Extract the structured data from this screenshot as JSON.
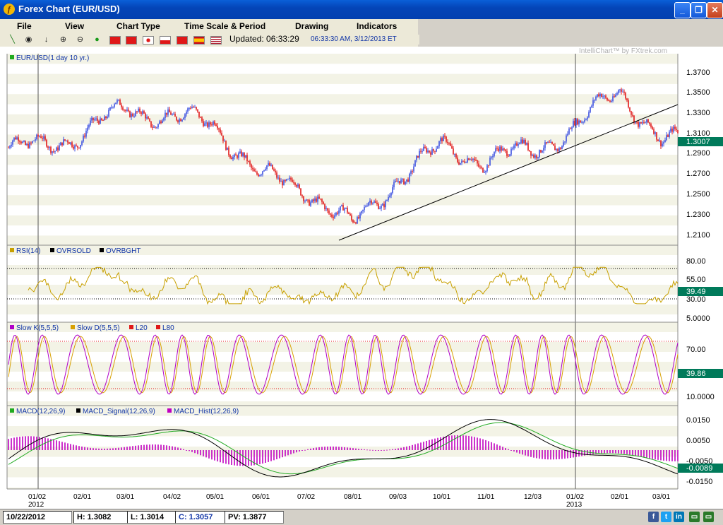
{
  "window": {
    "title": "Forex Chart (EUR/USD)",
    "app_icon": "ƒ"
  },
  "menu": [
    "File",
    "View",
    "Chart Type",
    "Time Scale & Period",
    "Drawing",
    "Indicators"
  ],
  "toolbar": {
    "updated_label": "Updated: 06:33:29",
    "timestamp": "06:33:30 AM, 3/12/2013 ET"
  },
  "watermark": "IntelliChart™ by FXtrek.com",
  "price_panel": {
    "legend": "EUR/USD(1 day  10 yr.)",
    "axis": [
      "1.3700",
      "1.3500",
      "1.3300",
      "1.3100",
      "1.2900",
      "1.2700",
      "1.2500",
      "1.2300",
      "1.2100"
    ],
    "last": "1.3007"
  },
  "rsi_panel": {
    "legend": [
      "RSI(14)",
      "OVRSOLD",
      "OVRBGHT"
    ],
    "axis": [
      "80.00",
      "55.00",
      "30.00"
    ],
    "last": "39.49"
  },
  "stoch_panel": {
    "legend": [
      "Slow K(5,5,5)",
      "Slow D(5,5,5)",
      "L20",
      "L80"
    ],
    "axis": [
      "5.0000",
      "70.00",
      "10.0000"
    ],
    "last": "39.86"
  },
  "macd_panel": {
    "legend": [
      "MACD(12,26,9)",
      "MACD_Signal(12,26,9)",
      "MACD_Hist(12,26,9)"
    ],
    "axis": [
      "0.0150",
      "0.0050",
      "-0.0050",
      "-0.0150"
    ],
    "last": "-0.0089"
  },
  "x_axis": {
    "ticks": [
      "01/02",
      "02/01",
      "03/01",
      "04/02",
      "05/01",
      "06/01",
      "07/02",
      "08/01",
      "09/03",
      "10/01",
      "11/01",
      "12/03",
      "01/02",
      "02/01",
      "03/01"
    ],
    "years": [
      "2012",
      "2013"
    ]
  },
  "status": {
    "date": "10/22/2012",
    "high": "H: 1.3082",
    "low": "L: 1.3014",
    "close": "C: 1.3057",
    "pv": "PV: 1.3877"
  },
  "colors": {
    "up": "#3b50e0",
    "down": "#e01818",
    "band": "#f3f3e6",
    "rsi": "#c8a000",
    "stoch_k": "#b000c8",
    "stoch_d": "#d8a000",
    "macd": "#000000",
    "signal": "#22aa22",
    "hist": "#c000c0",
    "last_box": "#007a5a"
  },
  "chart_data": {
    "type": "line",
    "title": "EUR/USD(1 day  10 yr.)",
    "x": [
      "01/02",
      "02/01",
      "03/01",
      "04/02",
      "05/01",
      "06/01",
      "07/02",
      "08/01",
      "09/03",
      "10/01",
      "11/01",
      "12/03",
      "01/02",
      "02/01",
      "03/01"
    ],
    "series": [
      {
        "name": "EUR/USD",
        "values": [
          1.295,
          1.31,
          1.335,
          1.325,
          1.32,
          1.265,
          1.255,
          1.215,
          1.265,
          1.295,
          1.283,
          1.293,
          1.315,
          1.355,
          1.3
        ]
      }
    ],
    "ylim": [
      1.2,
      1.38
    ]
  }
}
